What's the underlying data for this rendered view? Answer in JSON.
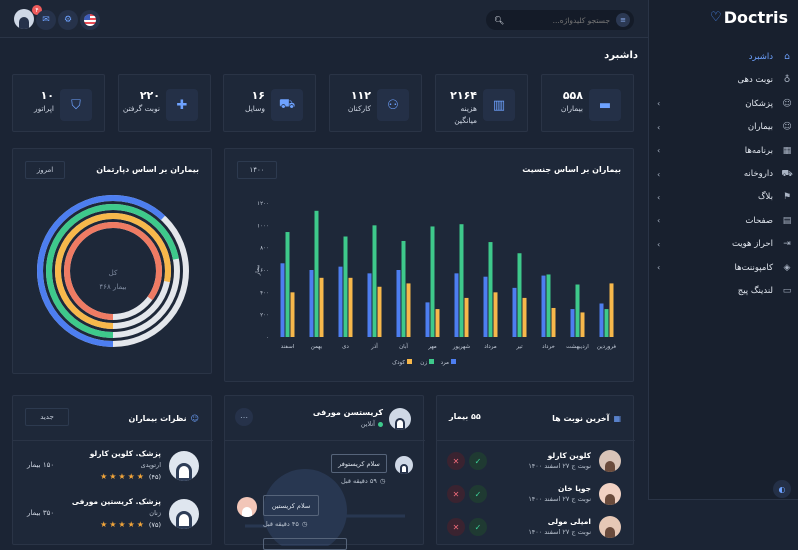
{
  "app": {
    "brand": "Doctris"
  },
  "sidebar": {
    "items": [
      {
        "label": "داشبرد",
        "icon": "home-icon",
        "active": true,
        "has_chevron": false
      },
      {
        "label": "نوبت دهی",
        "icon": "stethoscope-icon",
        "active": false,
        "has_chevron": false
      },
      {
        "label": "پزشکان",
        "icon": "user-icon",
        "active": false,
        "has_chevron": true
      },
      {
        "label": "بیماران",
        "icon": "user-icon",
        "active": false,
        "has_chevron": true
      },
      {
        "label": "برنامه‌ها",
        "icon": "grid-icon",
        "active": false,
        "has_chevron": true
      },
      {
        "label": "داروخانه",
        "icon": "cart-icon",
        "active": false,
        "has_chevron": true
      },
      {
        "label": "بلاگ",
        "icon": "flag-icon",
        "active": false,
        "has_chevron": true
      },
      {
        "label": "صفحات",
        "icon": "file-icon",
        "active": false,
        "has_chevron": true
      },
      {
        "label": "احراز هویت",
        "icon": "login-icon",
        "active": false,
        "has_chevron": true
      },
      {
        "label": "کامپوننت‌ها",
        "icon": "layers-icon",
        "active": false,
        "has_chevron": true
      },
      {
        "label": "لندینگ پیج",
        "icon": "browser-icon",
        "active": false,
        "has_chevron": false
      }
    ]
  },
  "topbar": {
    "search_placeholder": "جستجو کلیدواژه...",
    "notification_count": "۴"
  },
  "page_title": "داشبرد",
  "stats": [
    {
      "value": "۵۵۸",
      "label": "بیماران",
      "icon": "bed-icon"
    },
    {
      "value": "۲۱۶۴",
      "label": "هزینه میانگین",
      "icon": "file-chart-icon"
    },
    {
      "value": "۱۱۲",
      "label": "کارکنان",
      "icon": "people-icon"
    },
    {
      "value": "۱۶",
      "label": "وسایل",
      "icon": "ambulance-icon"
    },
    {
      "value": "۲۲۰",
      "label": "نوبت گرفتن",
      "icon": "medkit-icon"
    },
    {
      "value": "۱۰",
      "label": "اپراتور",
      "icon": "shield-icon"
    }
  ],
  "gender_chart": {
    "title": "بیماران بر اساس جنسیت",
    "year_select": "۱۴۰۰"
  },
  "chart_data": [
    {
      "type": "bar",
      "title": "بیماران بر اساس جنسیت",
      "categories": [
        "فروردین",
        "اردیبهشت",
        "خرداد",
        "تیر",
        "مرداد",
        "شهریور",
        "مهر",
        "آبان",
        "آذر",
        "دی",
        "بهمن",
        "اسفند"
      ],
      "series": [
        {
          "name": "مرد",
          "color": "#4d7ef0",
          "values": [
            300,
            250,
            550,
            440,
            540,
            570,
            310,
            600,
            570,
            630,
            600,
            660
          ]
        },
        {
          "name": "زن",
          "color": "#3ec98b",
          "values": [
            250,
            470,
            560,
            750,
            850,
            1010,
            990,
            860,
            1000,
            900,
            1130,
            940
          ]
        },
        {
          "name": "کودک",
          "color": "#f7b84b",
          "values": [
            480,
            220,
            260,
            350,
            400,
            350,
            250,
            480,
            450,
            530,
            530,
            400
          ]
        }
      ],
      "y_ticks": [
        "۰",
        "۲۰۰",
        "۴۰۰",
        "۶۰۰",
        "۸۰۰",
        "۱۰۰۰",
        "۱۲۰۰"
      ],
      "ylim": [
        0,
        1200
      ],
      "ylabel": "بیمار",
      "legend_position": "bottom"
    },
    {
      "type": "pie",
      "title": "بیماران بر اساس دپارتمان",
      "center_label": "کل",
      "center_value": "۴۶۸ بیمار",
      "series": [
        {
          "color": "#4d7ef0",
          "value": 0.62
        },
        {
          "color": "#3ec98b",
          "value": 0.72
        },
        {
          "color": "#f7b84b",
          "value": 0.78
        },
        {
          "color": "#ef7b63",
          "value": 0.85
        }
      ]
    }
  ],
  "dept_chart": {
    "title": "بیماران بر اساس دپارتمان",
    "select": "امروز",
    "center_label": "کل",
    "center_value": "۴۶۸ بیمار"
  },
  "reviews": {
    "title": "نظرات بیماران",
    "select": "جدید",
    "items": [
      {
        "name": "پزشک. کلوین کارلو",
        "specialty": "ارتوپدی",
        "count": "۱۵۰ بیمار",
        "rating": "(۴۵)"
      },
      {
        "name": "پزشک. کریستین مورفی",
        "specialty": "زنان",
        "count": "۳۵۰ بیمار",
        "rating": "(۷۵)"
      }
    ]
  },
  "chat": {
    "name": "کریستسن مورفی",
    "status": "آنلاین",
    "messages": [
      {
        "text": "سلام کریستوفر",
        "time": "۵۹ دقیقه قبل"
      },
      {
        "text": "سلام کریستین",
        "time": "۴۵ دقیقه قبل"
      }
    ]
  },
  "appointments": {
    "title": "آخرین نوبت ها",
    "count": "۵۵ بیمار",
    "items": [
      {
        "name": "کلوین کارلو",
        "when": "نوبت ج ۲۷ اسفند ۱۴۰۰"
      },
      {
        "name": "جویا خان",
        "when": "نوبت ج ۲۷ اسفند ۱۴۰۰"
      },
      {
        "name": "امیلی مولی",
        "when": "نوبت ج ۲۷ اسفند ۱۴۰۰"
      }
    ]
  }
}
